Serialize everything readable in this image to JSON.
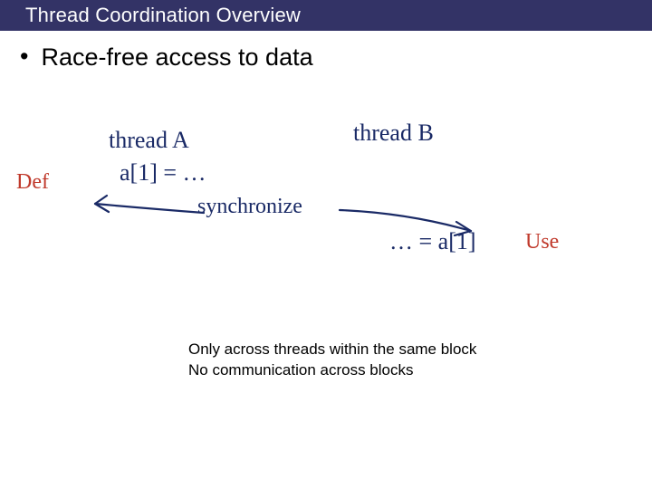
{
  "slide": {
    "title": "Thread Coordination Overview",
    "bullet1": "Race-free access to data",
    "handwriting": {
      "threadA_label": "thread A",
      "threadA_code": "a[1] = …",
      "def_label": "Def",
      "sync_label": "synchronize",
      "threadB_label": "thread  B",
      "threadB_code": "… = a[1]",
      "use_label": "Use"
    },
    "footer_line1": "Only across threads within the same block",
    "footer_line2": "No communication across blocks"
  }
}
